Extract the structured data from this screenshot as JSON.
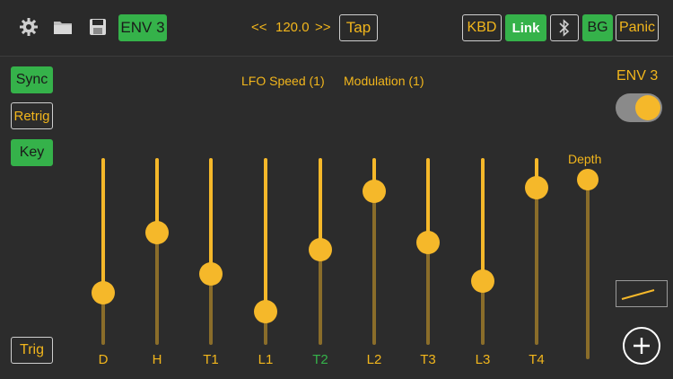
{
  "toolbar": {
    "env_button": "ENV 3",
    "tempo_prev": "<<",
    "tempo": "120.0",
    "tempo_next": ">>",
    "tap": "Tap",
    "kbd": "KBD",
    "link": "Link",
    "bg": "BG",
    "panic": "Panic"
  },
  "left_buttons": {
    "sync": "Sync",
    "retrig": "Retrig",
    "key": "Key",
    "trig": "Trig"
  },
  "header_labels": {
    "lfo_speed": "LFO Speed (1)",
    "modulation": "Modulation (1)"
  },
  "right_panel": {
    "env_title": "ENV 3",
    "toggle_on": true,
    "depth_label": "Depth"
  },
  "faders": [
    {
      "label": "D",
      "value": 0.28,
      "active": false
    },
    {
      "label": "H",
      "value": 0.6,
      "active": false
    },
    {
      "label": "T1",
      "value": 0.38,
      "active": false
    },
    {
      "label": "L1",
      "value": 0.18,
      "active": false
    },
    {
      "label": "T2",
      "value": 0.51,
      "active": true
    },
    {
      "label": "L2",
      "value": 0.82,
      "active": false
    },
    {
      "label": "T3",
      "value": 0.55,
      "active": false
    },
    {
      "label": "L3",
      "value": 0.34,
      "active": false
    },
    {
      "label": "T4",
      "value": 0.84,
      "active": false
    }
  ],
  "depth": {
    "value": 0.98
  },
  "colors": {
    "accent": "#f2b61c",
    "active_label": "#35b24a",
    "button_green": "#35b24a",
    "background": "#2c2c2c"
  }
}
